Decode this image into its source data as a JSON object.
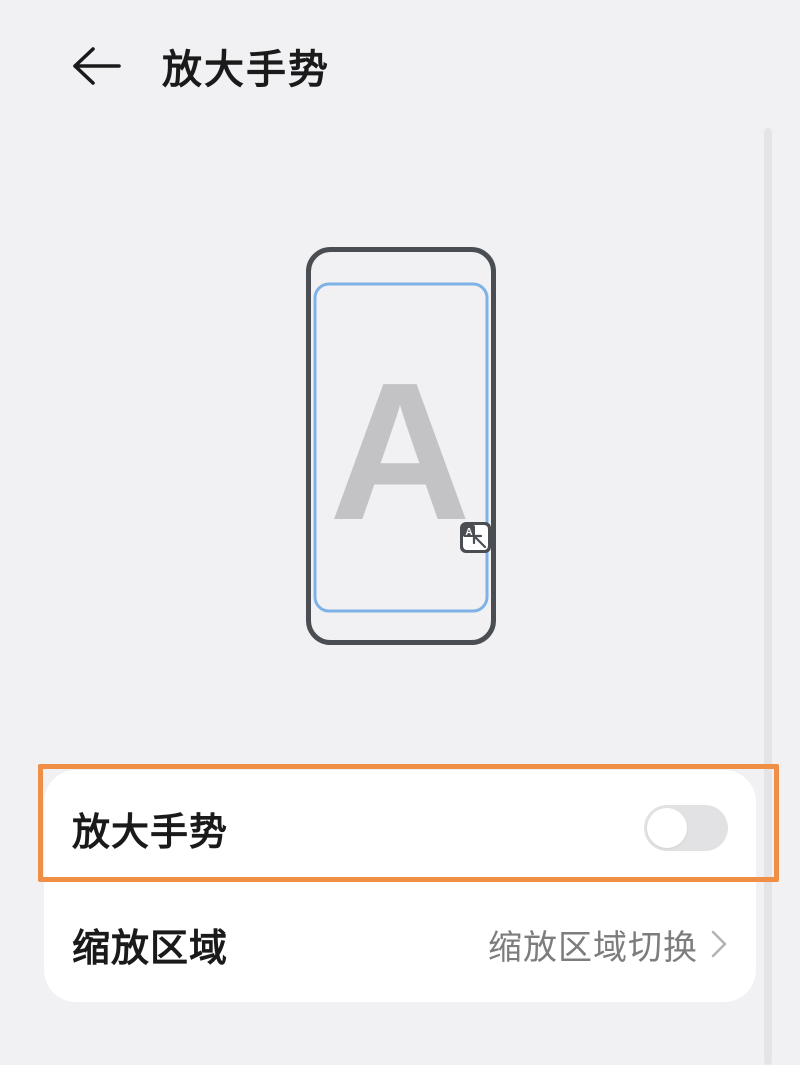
{
  "header": {
    "title": "放大手势",
    "back_icon": "arrow-left-icon"
  },
  "illustration": {
    "glyph": "A",
    "badge_icon": "magnify-gesture-icon",
    "badge_letter": "A"
  },
  "settings": {
    "rows": [
      {
        "label": "放大手势",
        "control": "toggle",
        "enabled": false
      },
      {
        "label": "缩放区域",
        "value": "缩放区域切换",
        "icon": "chevron-right-icon"
      }
    ]
  },
  "colors": {
    "background": "#f1f1f3",
    "card": "#ffffff",
    "highlight": "#f08e45",
    "phone_frame": "#4a4d52",
    "screen_outline": "#7eb2e6",
    "glyph": "#c3c3c5"
  }
}
